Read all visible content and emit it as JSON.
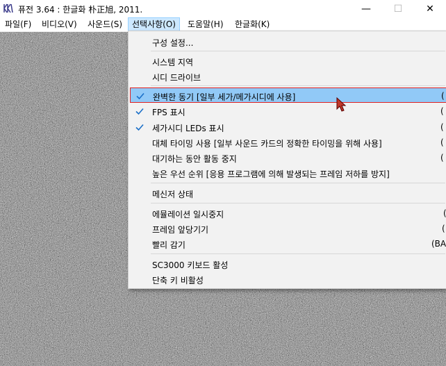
{
  "window": {
    "title": "퓨전 3.64 : 한글화 朴正旭, 2011.",
    "controls": {
      "minimize": "—",
      "maximize": "☐",
      "close": "✕"
    }
  },
  "menubar": [
    {
      "label": "파일(F)"
    },
    {
      "label": "비디오(V)"
    },
    {
      "label": "사운드(S)"
    },
    {
      "label": "선택사항(O)"
    },
    {
      "label": "도움말(H)"
    },
    {
      "label": "한글화(K)"
    }
  ],
  "dropdown": {
    "items": [
      {
        "label": "구성 설정...",
        "shortcut": ""
      },
      {
        "label": "시스템 지역",
        "shortcut": ""
      },
      {
        "label": "시디 드라이브",
        "shortcut": ""
      },
      {
        "label": "완벽한 동기 [일부 세가/메가시디에 사용]",
        "shortcut": "(",
        "checked": true
      },
      {
        "label": "FPS 표시",
        "shortcut": "(",
        "checked": true
      },
      {
        "label": "세가시디 LEDs 표시",
        "shortcut": "(",
        "checked": true
      },
      {
        "label": "대체 타이밍 사용 [일부 사운드 카드의 정확한 타이밍을 위해 사용]",
        "shortcut": "("
      },
      {
        "label": "대기하는 동안 활동 중지",
        "shortcut": "("
      },
      {
        "label": "높은 우선 순위 [응용 프로그램에 의해 발생되는 프레임 저하를 방지]",
        "shortcut": ""
      },
      {
        "label": "메신저 상태",
        "shortcut": ""
      },
      {
        "label": "에뮬레이션 일시중지",
        "shortcut": "("
      },
      {
        "label": "프레임 앞당기기",
        "shortcut": "("
      },
      {
        "label": "빨리 감기",
        "shortcut": "(BAC"
      },
      {
        "label": "SC3000 키보드 활성",
        "shortcut": ""
      },
      {
        "label": "단축 키 비활성",
        "shortcut": ""
      }
    ]
  },
  "colors": {
    "highlight": "#91c9f7",
    "highlight_border": "#e02020",
    "check": "#1a6fc8",
    "menu_active": "#cce8ff"
  }
}
